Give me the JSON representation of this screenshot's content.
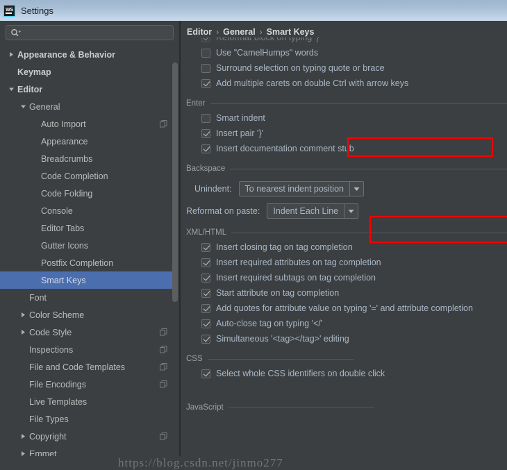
{
  "window": {
    "title": "Settings",
    "app_icon": "webstorm-icon",
    "titlebar_color": "#a9bfd6"
  },
  "search": {
    "value": "",
    "placeholder": "",
    "icon": "search-icon"
  },
  "sidebar": {
    "scrollbar": true,
    "items": [
      {
        "label": "Appearance & Behavior",
        "indent": 0,
        "arrow": "collapsed",
        "bold": true,
        "badge": false,
        "selected": false
      },
      {
        "label": "Keymap",
        "indent": 0,
        "arrow": "none",
        "bold": true,
        "badge": false,
        "selected": false
      },
      {
        "label": "Editor",
        "indent": 0,
        "arrow": "expanded",
        "bold": true,
        "badge": false,
        "selected": false
      },
      {
        "label": "General",
        "indent": 1,
        "arrow": "expanded",
        "bold": false,
        "badge": false,
        "selected": false
      },
      {
        "label": "Auto Import",
        "indent": 2,
        "arrow": "none",
        "bold": false,
        "badge": true,
        "selected": false
      },
      {
        "label": "Appearance",
        "indent": 2,
        "arrow": "none",
        "bold": false,
        "badge": false,
        "selected": false
      },
      {
        "label": "Breadcrumbs",
        "indent": 2,
        "arrow": "none",
        "bold": false,
        "badge": false,
        "selected": false
      },
      {
        "label": "Code Completion",
        "indent": 2,
        "arrow": "none",
        "bold": false,
        "badge": false,
        "selected": false
      },
      {
        "label": "Code Folding",
        "indent": 2,
        "arrow": "none",
        "bold": false,
        "badge": false,
        "selected": false
      },
      {
        "label": "Console",
        "indent": 2,
        "arrow": "none",
        "bold": false,
        "badge": false,
        "selected": false
      },
      {
        "label": "Editor Tabs",
        "indent": 2,
        "arrow": "none",
        "bold": false,
        "badge": false,
        "selected": false
      },
      {
        "label": "Gutter Icons",
        "indent": 2,
        "arrow": "none",
        "bold": false,
        "badge": false,
        "selected": false
      },
      {
        "label": "Postfix Completion",
        "indent": 2,
        "arrow": "none",
        "bold": false,
        "badge": false,
        "selected": false
      },
      {
        "label": "Smart Keys",
        "indent": 2,
        "arrow": "none",
        "bold": false,
        "badge": false,
        "selected": true
      },
      {
        "label": "Font",
        "indent": 1,
        "arrow": "none",
        "bold": false,
        "badge": false,
        "selected": false
      },
      {
        "label": "Color Scheme",
        "indent": 1,
        "arrow": "collapsed",
        "bold": false,
        "badge": false,
        "selected": false
      },
      {
        "label": "Code Style",
        "indent": 1,
        "arrow": "collapsed",
        "bold": false,
        "badge": true,
        "selected": false
      },
      {
        "label": "Inspections",
        "indent": 1,
        "arrow": "none",
        "bold": false,
        "badge": true,
        "selected": false
      },
      {
        "label": "File and Code Templates",
        "indent": 1,
        "arrow": "none",
        "bold": false,
        "badge": true,
        "selected": false
      },
      {
        "label": "File Encodings",
        "indent": 1,
        "arrow": "none",
        "bold": false,
        "badge": true,
        "selected": false
      },
      {
        "label": "Live Templates",
        "indent": 1,
        "arrow": "none",
        "bold": false,
        "badge": false,
        "selected": false
      },
      {
        "label": "File Types",
        "indent": 1,
        "arrow": "none",
        "bold": false,
        "badge": false,
        "selected": false
      },
      {
        "label": "Copyright",
        "indent": 1,
        "arrow": "collapsed",
        "bold": false,
        "badge": true,
        "selected": false
      },
      {
        "label": "Emmet",
        "indent": 1,
        "arrow": "collapsed",
        "bold": false,
        "badge": false,
        "selected": false
      }
    ]
  },
  "breadcrumb": {
    "parts": [
      "Editor",
      "General",
      "Smart Keys"
    ],
    "separator": "›"
  },
  "settings": {
    "top_options": [
      {
        "label": "Reformat block on typing '}'",
        "checked": true,
        "clipped": true
      },
      {
        "label": "Use \"CamelHumps\" words",
        "checked": false,
        "clipped": false
      },
      {
        "label": "Surround selection on typing quote or brace",
        "checked": false,
        "clipped": false
      },
      {
        "label": "Add multiple carets on double Ctrl with arrow keys",
        "checked": true,
        "clipped": false
      }
    ],
    "enter_group": {
      "title": "Enter",
      "options": [
        {
          "label": "Smart indent",
          "checked": false
        },
        {
          "label": "Insert pair '}'",
          "checked": true
        },
        {
          "label": "Insert documentation comment stub",
          "checked": true
        }
      ]
    },
    "backspace_group": {
      "title": "Backspace",
      "unindent_label": "Unindent:",
      "unindent_value": "To nearest indent position",
      "reformat_label": "Reformat on paste:",
      "reformat_value": "Indent Each Line"
    },
    "xml_group": {
      "title": "XML/HTML",
      "options": [
        {
          "label": "Insert closing tag on tag completion",
          "checked": true
        },
        {
          "label": "Insert required attributes on tag completion",
          "checked": true
        },
        {
          "label": "Insert required subtags on tag completion",
          "checked": true
        },
        {
          "label": "Start attribute on tag completion",
          "checked": true
        },
        {
          "label": "Add quotes for attribute value on typing '=' and attribute completion",
          "checked": true
        },
        {
          "label": "Auto-close tag on typing '</'",
          "checked": true
        },
        {
          "label": "Simultaneous '<tag></tag>' editing",
          "checked": true
        }
      ]
    },
    "css_group": {
      "title": "CSS",
      "options": [
        {
          "label": "Select whole CSS identifiers on double click",
          "checked": true
        }
      ]
    },
    "javascript_group": {
      "title": "JavaScript"
    }
  },
  "annotations": {
    "highlight_color": "#fe0000",
    "boxes": [
      "smart-indent-highlight",
      "unindent-highlight"
    ]
  },
  "watermark": {
    "text": "https://blog.csdn.net/jinmo277"
  }
}
